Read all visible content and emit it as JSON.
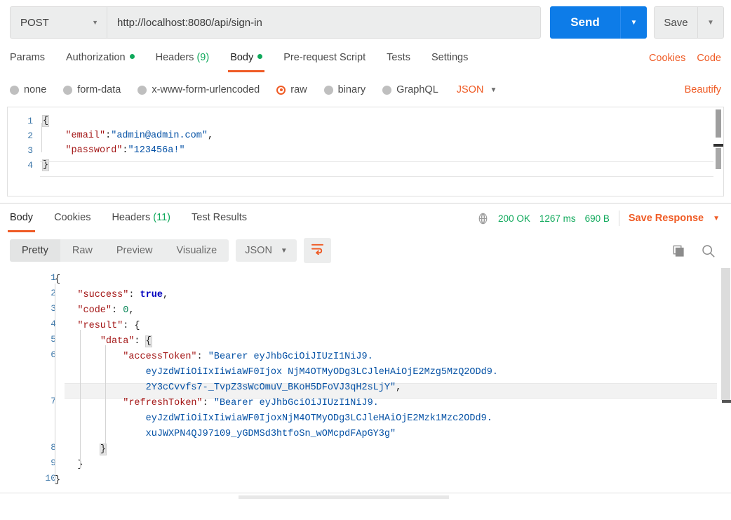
{
  "urlbar": {
    "method": "POST",
    "url": "http://localhost:8080/api/sign-in",
    "send_label": "Send",
    "save_label": "Save",
    "method_caret": "▼",
    "send_caret": "▼",
    "save_caret": "▼"
  },
  "request_tabs": {
    "items": [
      {
        "label": "Params",
        "active": false,
        "marker": ""
      },
      {
        "label": "Authorization",
        "active": false,
        "marker": "dot"
      },
      {
        "label": "Headers",
        "active": false,
        "marker": "count",
        "count": "(9)"
      },
      {
        "label": "Body",
        "active": true,
        "marker": "dot"
      },
      {
        "label": "Pre-request Script",
        "active": false,
        "marker": ""
      },
      {
        "label": "Tests",
        "active": false,
        "marker": ""
      },
      {
        "label": "Settings",
        "active": false,
        "marker": ""
      }
    ],
    "cookies_label": "Cookies",
    "code_label": "Code"
  },
  "body_types": {
    "options": [
      {
        "label": "none",
        "selected": false
      },
      {
        "label": "form-data",
        "selected": false
      },
      {
        "label": "x-www-form-urlencoded",
        "selected": false
      },
      {
        "label": "raw",
        "selected": true
      },
      {
        "label": "binary",
        "selected": false
      },
      {
        "label": "GraphQL",
        "selected": false
      }
    ],
    "format": "JSON",
    "format_caret": "▼",
    "beautify_label": "Beautify"
  },
  "request_body": {
    "line_numbers": [
      "1",
      "2",
      "3",
      "4"
    ],
    "lines": [
      [
        {
          "t": "{",
          "c": "punct"
        }
      ],
      [
        {
          "t": "    ",
          "c": "punct"
        },
        {
          "t": "\"email\"",
          "c": "key"
        },
        {
          "t": ":",
          "c": "punct"
        },
        {
          "t": "\"admin@admin.com\"",
          "c": "str"
        },
        {
          "t": ",",
          "c": "punct"
        }
      ],
      [
        {
          "t": "    ",
          "c": "punct"
        },
        {
          "t": "\"password\"",
          "c": "key"
        },
        {
          "t": ":",
          "c": "punct"
        },
        {
          "t": "\"123456a!\"",
          "c": "str"
        }
      ],
      [
        {
          "t": "}",
          "c": "punct"
        }
      ]
    ]
  },
  "response_tabs": {
    "items": [
      {
        "label": "Body",
        "active": true,
        "marker": ""
      },
      {
        "label": "Cookies",
        "active": false,
        "marker": ""
      },
      {
        "label": "Headers",
        "active": false,
        "marker": "count",
        "count": "(11)"
      },
      {
        "label": "Test Results",
        "active": false,
        "marker": ""
      }
    ],
    "status": "200 OK",
    "time": "1267 ms",
    "size": "690 B",
    "save_response_label": "Save Response",
    "save_response_caret": "▼"
  },
  "response_toolbar": {
    "views": [
      {
        "label": "Pretty",
        "active": true
      },
      {
        "label": "Raw",
        "active": false
      },
      {
        "label": "Preview",
        "active": false
      },
      {
        "label": "Visualize",
        "active": false
      }
    ],
    "format": "JSON",
    "format_caret": "▼",
    "wrap_icon": "word-wrap-icon",
    "copy_icon": "copy-icon",
    "search_icon": "search-icon"
  },
  "response_body": {
    "line_numbers": [
      "1",
      "2",
      "3",
      "4",
      "5",
      "6",
      "",
      "",
      "7",
      "",
      "",
      "8",
      "9",
      "10"
    ],
    "lines": [
      [
        {
          "t": "{",
          "c": "punct"
        }
      ],
      [
        {
          "t": "    ",
          "c": "punct"
        },
        {
          "t": "\"success\"",
          "c": "key"
        },
        {
          "t": ": ",
          "c": "punct"
        },
        {
          "t": "true",
          "c": "bool"
        },
        {
          "t": ",",
          "c": "punct"
        }
      ],
      [
        {
          "t": "    ",
          "c": "punct"
        },
        {
          "t": "\"code\"",
          "c": "key"
        },
        {
          "t": ": ",
          "c": "punct"
        },
        {
          "t": "0",
          "c": "num"
        },
        {
          "t": ",",
          "c": "punct"
        }
      ],
      [
        {
          "t": "    ",
          "c": "punct"
        },
        {
          "t": "\"result\"",
          "c": "key"
        },
        {
          "t": ": ",
          "c": "punct"
        },
        {
          "t": "{",
          "c": "punct"
        }
      ],
      [
        {
          "t": "        ",
          "c": "punct"
        },
        {
          "t": "\"data\"",
          "c": "key"
        },
        {
          "t": ": ",
          "c": "punct"
        },
        {
          "t": "{",
          "c": "punct"
        }
      ],
      [
        {
          "t": "            ",
          "c": "punct"
        },
        {
          "t": "\"accessToken\"",
          "c": "key"
        },
        {
          "t": ": ",
          "c": "punct"
        },
        {
          "t": "\"Bearer eyJhbGciOiJIUzI1NiJ9.",
          "c": "str"
        }
      ],
      [
        {
          "t": "                ",
          "c": "punct"
        },
        {
          "t": "eyJzdWIiOiIxIiwiaWF0Ijox NjM4OTMyODg3LCJleHAiOjE2Mzg5MzQ2ODd9.",
          "c": "str"
        }
      ],
      [
        {
          "t": "                ",
          "c": "punct"
        },
        {
          "t": "2Y3cCvvfs7-_TvpZ3sWcOmuV_BKoH5DFoVJ3qH2sLjY\"",
          "c": "str"
        },
        {
          "t": ",",
          "c": "punct"
        }
      ],
      [
        {
          "t": "            ",
          "c": "punct"
        },
        {
          "t": "\"refreshToken\"",
          "c": "key"
        },
        {
          "t": ": ",
          "c": "punct"
        },
        {
          "t": "\"Bearer eyJhbGciOiJIUzI1NiJ9.",
          "c": "str"
        }
      ],
      [
        {
          "t": "                ",
          "c": "punct"
        },
        {
          "t": "eyJzdWIiOiIxIiwiaWF0IjoxNjM4OTMyODg3LCJleHAiOjE2Mzk1Mzc2ODd9.",
          "c": "str"
        }
      ],
      [
        {
          "t": "                ",
          "c": "punct"
        },
        {
          "t": "xuJWXPN4QJ97109_yGDMSd3htfoSn_wOMcpdFApGY3g\"",
          "c": "str"
        }
      ],
      [
        {
          "t": "        ",
          "c": "punct"
        },
        {
          "t": "}",
          "c": "punct"
        }
      ],
      [
        {
          "t": "    ",
          "c": "punct"
        },
        {
          "t": "}",
          "c": "punct"
        }
      ],
      [
        {
          "t": "}",
          "c": "punct"
        }
      ]
    ]
  },
  "colors": {
    "accent_orange": "#ef5b25",
    "send_blue": "#0d7ce8",
    "status_green": "#0fa95b",
    "json_key": "#a31515",
    "json_string": "#0451a5"
  }
}
